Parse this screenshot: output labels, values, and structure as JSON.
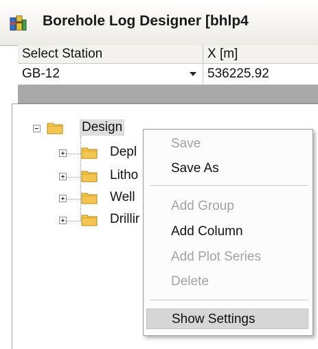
{
  "window": {
    "title": "Borehole Log Designer [bhlp4",
    "icon": "app-icon"
  },
  "station_grid": {
    "columns": [
      "Select Station",
      "X [m]"
    ],
    "row": {
      "station": "GB-12",
      "x": "536225.92"
    }
  },
  "tree": {
    "root": {
      "label": "Design",
      "icon": "folder-icon"
    },
    "children": [
      {
        "label": "Depl",
        "icon": "folder-icon"
      },
      {
        "label": "Litho",
        "icon": "folder-icon"
      },
      {
        "label": "Well",
        "icon": "folder-icon"
      },
      {
        "label": "Drillir",
        "icon": "folder-icon"
      }
    ]
  },
  "context_menu": {
    "items": [
      {
        "label": "Save",
        "enabled": false
      },
      {
        "label": "Save As",
        "enabled": true
      },
      {
        "label": "Add Group",
        "enabled": false
      },
      {
        "label": "Add Column",
        "enabled": true
      },
      {
        "label": "Add Plot Series",
        "enabled": false
      },
      {
        "label": "Delete",
        "enabled": false
      },
      {
        "label": "Show Settings",
        "enabled": true,
        "highlighted": true
      }
    ]
  },
  "colors": {
    "folder": "#f4c64f",
    "disabled_text": "#a3a3a3",
    "highlight": "#d6d6d6",
    "band": "#a9a9a9"
  }
}
